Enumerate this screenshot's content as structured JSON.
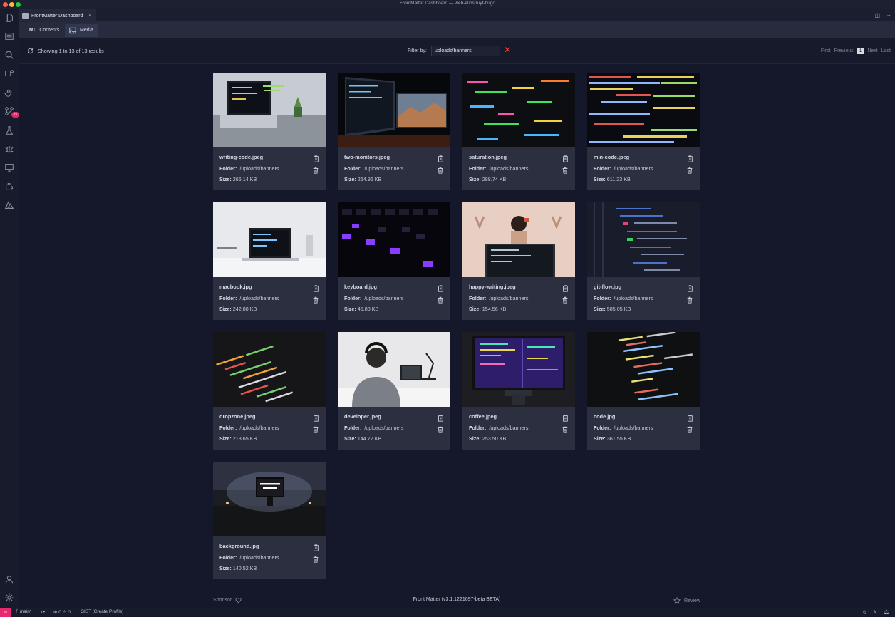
{
  "window": {
    "title": "FrontMatter Dashboard — web-eliostruyf-hugo"
  },
  "tab": {
    "label": "FrontMatter Dashboard"
  },
  "subnav": {
    "contents_label": "Contents",
    "contents_glyph": "M↓",
    "media_label": "Media"
  },
  "toolbar": {
    "results_text": "Showing 1 to 13 of 13 results",
    "filter_label": "Filter by:",
    "filter_value": "uploads/banners",
    "pager": {
      "first": "First",
      "previous": "Previous",
      "page": "1",
      "next": "Next",
      "last": "Last"
    }
  },
  "labels": {
    "folder": "Folder:",
    "size": "Size:"
  },
  "media": [
    {
      "name": "writing-code.jpeg",
      "folder": "/uploads/banners",
      "size": "266.14 KB"
    },
    {
      "name": "two-monitors.jpeg",
      "folder": "/uploads/banners",
      "size": "264.96 KB"
    },
    {
      "name": "saturation.jpeg",
      "folder": "/uploads/banners",
      "size": "288.74 KB"
    },
    {
      "name": "min-code.jpeg",
      "folder": "/uploads/banners",
      "size": "611.23 KB"
    },
    {
      "name": "macbook.jpg",
      "folder": "/uploads/banners",
      "size": "242.80 KB"
    },
    {
      "name": "keyboard.jpg",
      "folder": "/uploads/banners",
      "size": "45.88 KB"
    },
    {
      "name": "happy-writing.jpeg",
      "folder": "/uploads/banners",
      "size": "154.56 KB"
    },
    {
      "name": "git-flow.jpg",
      "folder": "/uploads/banners",
      "size": "585.05 KB"
    },
    {
      "name": "dropzone.jpeg",
      "folder": "/uploads/banners",
      "size": "213.65 KB"
    },
    {
      "name": "developer.jpeg",
      "folder": "/uploads/banners",
      "size": "144.72 KB"
    },
    {
      "name": "coffee.jpeg",
      "folder": "/uploads/banners",
      "size": "253.50 KB"
    },
    {
      "name": "code.jpg",
      "folder": "/uploads/banners",
      "size": "361.55 KB"
    },
    {
      "name": "background.jpg",
      "folder": "/uploads/banners",
      "size": "140.52 KB"
    }
  ],
  "footer": {
    "sponsor": "Sponsor",
    "version": "Front Matter (v3.1.1221697-beta BETA)",
    "review": "Review"
  },
  "statusbar": {
    "branch": "main*",
    "problems": "⊗ 0 ⚠ 0",
    "gist": "GIST [Create Profile]"
  },
  "activity": {
    "badge": "15"
  },
  "colors": {
    "accent": "#e8286e",
    "clear": "#e5483e",
    "card_bg": "#2b2f40",
    "page_bg": "#15182a"
  }
}
